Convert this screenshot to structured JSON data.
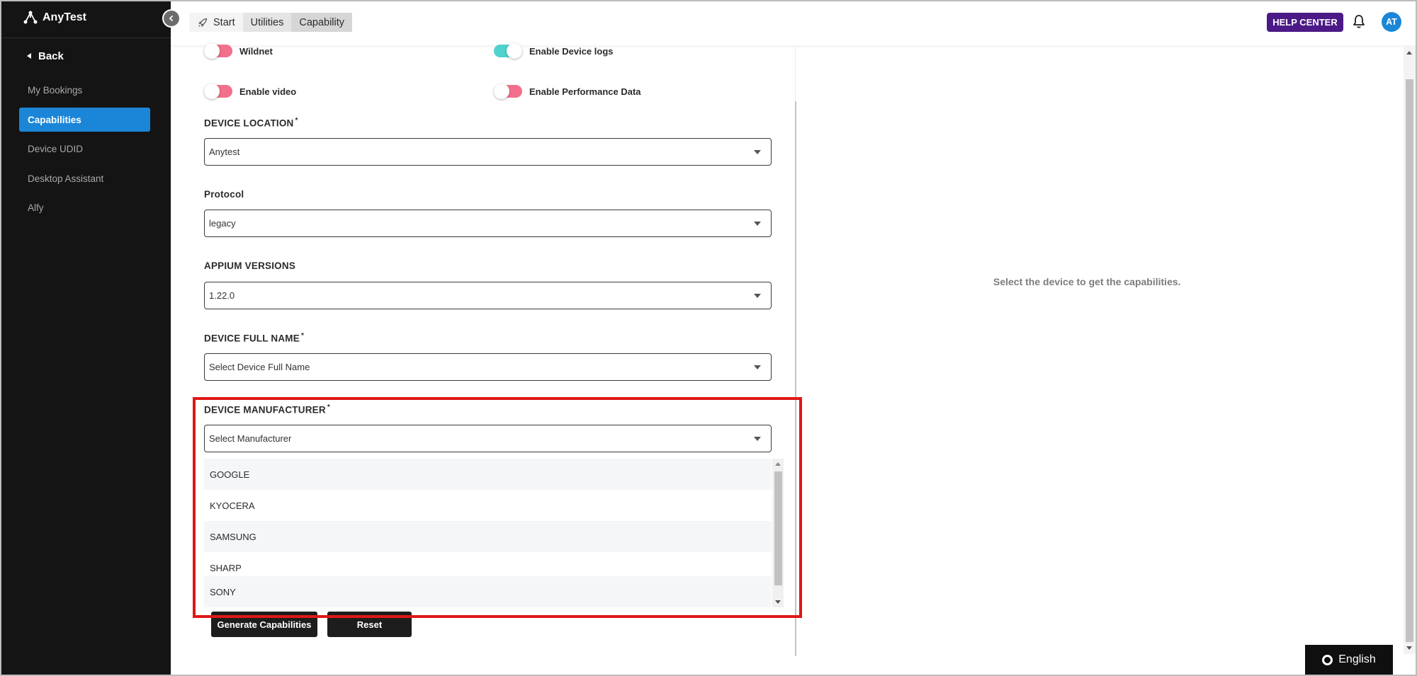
{
  "app": {
    "logo_text": "AnyTest"
  },
  "sidebar": {
    "back_label": "Back",
    "items": [
      {
        "label": "My Bookings",
        "active": false
      },
      {
        "label": "Capabilities",
        "active": true
      },
      {
        "label": "Device UDID",
        "active": false
      },
      {
        "label": "Desktop Assistant",
        "active": false
      },
      {
        "label": "Alfy",
        "active": false
      }
    ]
  },
  "header": {
    "tabs": [
      {
        "label": "Start"
      },
      {
        "label": "Utilities"
      },
      {
        "label": "Capability"
      }
    ],
    "help_label": "HELP CENTER",
    "avatar_initials": "AT"
  },
  "toggles": [
    {
      "label": "Wildnet",
      "on": false
    },
    {
      "label": "Enable Device logs",
      "on": true
    },
    {
      "label": "Enable video",
      "on": false
    },
    {
      "label": "Enable Performance Data",
      "on": false
    }
  ],
  "fields": {
    "device_location": {
      "label": "DEVICE LOCATION",
      "required": "*",
      "value": "Anytest"
    },
    "protocol": {
      "label": "Protocol",
      "value": "legacy"
    },
    "appium_versions": {
      "label": "APPIUM VERSIONS",
      "value": "1.22.0"
    },
    "device_full_name": {
      "label": "DEVICE FULL NAME",
      "required": "*",
      "placeholder": "Select Device Full Name"
    },
    "device_manufacturer": {
      "label": "DEVICE MANUFACTURER",
      "required": "*",
      "placeholder": "Select Manufacturer"
    }
  },
  "manufacturer_options": [
    "GOOGLE",
    "KYOCERA",
    "SAMSUNG",
    "SHARP",
    "SONY"
  ],
  "buttons": {
    "generate": "Generate Capabilities",
    "reset": "Reset"
  },
  "right_panel": {
    "message": "Select the device to get the capabilities."
  },
  "language": {
    "label": "English"
  },
  "colors": {
    "sidebar_bg": "#141414",
    "accent": "#1b86d8",
    "help_button": "#4b1a86",
    "toggle_off": "#f2708c",
    "toggle_on": "#4fd1cd",
    "highlight_border": "#e01717"
  }
}
